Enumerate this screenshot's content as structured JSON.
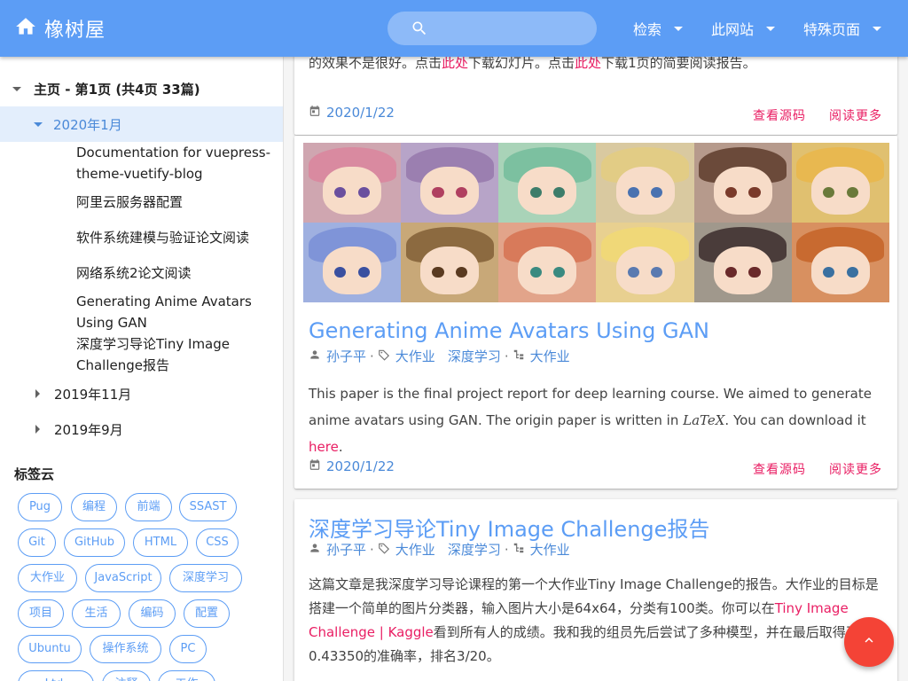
{
  "app": {
    "title": "橡树屋"
  },
  "search": {
    "placeholder": ""
  },
  "nav": [
    {
      "label": "检索"
    },
    {
      "label": "此网站"
    },
    {
      "label": "特殊页面"
    }
  ],
  "sidebar": {
    "root_label": "主页 - 第1页 (共4页 33篇)",
    "active_month": "2020年1月",
    "posts": [
      "Documentation for vuepress-theme-vuetify-blog",
      "阿里云服务器配置",
      "软件系统建模与验证论文阅读",
      "网络系统2论文阅读",
      "Generating Anime Avatars Using GAN",
      "深度学习导论Tiny Image Challenge报告"
    ],
    "months": [
      "2019年11月",
      "2019年9月"
    ],
    "tag_cloud_title": "标签云",
    "tags": [
      "Pug",
      "编程",
      "前端",
      "SSAST",
      "Git",
      "GitHub",
      "HTML",
      "CSS",
      "大作业",
      "JavaScript",
      "深度学习",
      "项目",
      "生活",
      "编码",
      "配置",
      "Ubuntu",
      "操作系统",
      "PC",
      "Ltd.",
      "注释",
      "工作"
    ]
  },
  "card1": {
    "excerpt_a": "的效果不是很好。点击",
    "link1": "此处",
    "excerpt_b": "下载幻灯片。点击",
    "link2": "此处",
    "excerpt_c": "下载1页的简要阅读报告。",
    "date": "2020/1/22",
    "view_source": "查看源码",
    "read_more": "阅读更多"
  },
  "card2": {
    "title": "Generating Anime Avatars Using GAN",
    "author": "孙子平",
    "tag1": "大作业",
    "tag2": "深度学习",
    "category": "大作业",
    "excerpt_a": "This paper is the final project report for deep learning course. We aimed to generate anime avatars using GAN. The origin paper is written in",
    "latex": "LaTeX",
    "excerpt_b": ". You can download it",
    "link": "here",
    "excerpt_c": ".",
    "date": "2020/1/22",
    "view_source": "查看源码",
    "read_more": "阅读更多"
  },
  "card3": {
    "title": "深度学习导论Tiny Image Challenge报告",
    "author": "孙子平",
    "tag1": "大作业",
    "tag2": "深度学习",
    "category": "大作业",
    "excerpt_a": "这篇文章是我深度学习导论课程的第一个大作业Tiny Image Challenge的报告。大作业的目标是搭建一个简单的图片分类器，输入图片大小是64x64，分类有100类。你可以在",
    "link": "Tiny Image Challenge | Kaggle",
    "excerpt_b": "看到所有人的成绩。我和我的组员先后尝试了多种模型，并在最后取得了0.43350的准确率，排名3/20。"
  },
  "colors": {
    "primary": "#5c9df5",
    "accent": "#e91e63",
    "fab": "#f44336",
    "active_bg": "#e3eefc"
  }
}
